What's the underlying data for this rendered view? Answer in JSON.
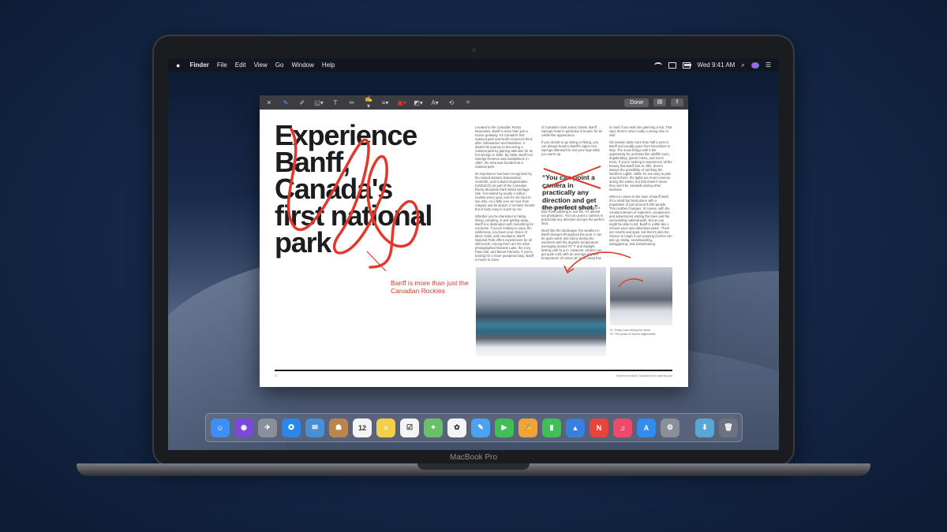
{
  "device": {
    "brand_label": "MacBook Pro"
  },
  "menubar": {
    "apple": "",
    "app_name": "Finder",
    "items": [
      "File",
      "Edit",
      "View",
      "Go",
      "Window",
      "Help"
    ],
    "clock": "Wed 9:41 AM"
  },
  "toolbar": {
    "done_label": "Done",
    "icons": [
      "close-icon",
      "sketch-icon",
      "draw-icon",
      "shapes-icon",
      "text-icon",
      "highlight-icon",
      "sign-icon",
      "line-style-icon",
      "border-color-icon",
      "fill-color-icon",
      "font-icon",
      "rotate-icon",
      "crop-icon",
      "trash-icon",
      "share-icon"
    ]
  },
  "document": {
    "headline": "Experience Banff, Canada's first national park",
    "headline_lines": [
      "Experience",
      "Banff,",
      "Canada's",
      "first national",
      "park"
    ],
    "col1": [
      "Located in the Canadian Rocky Mountains, Banff is more than just a scenic getaway. It's Canada's first national park and North America's third, after Yellowstone and Mackinac. It started its journey to becoming a national park by gaining attention for its hot springs in 1883. By 1885, Banff Hot Springs Reserve was established. In 1887, the area was founded as a national park.",
      "Its importance has been recognized by the United Nations Educational, Scientific, and Cultural Organization (UNESCO) as part of the Canadian Rocky Mountain Park World Heritage Site. It is visited by nearly 4 million tourists every year, and it's not hard to see why. As a little over an hour from Calgary and its airport, it remains remote but is fairly easy to reach by car.",
      "Whether you're interested in hiking, skiing, camping, or just getting away, Banff is a destination with something for everyone. If you're looking to enjoy the wilderness, you have your choice of lakes, trails, and mountains. Banff National Park offers experiences for all skill levels. Among them are the often-photographed Moraine Lake, the Cory Pass trail, and Mount Fairview. If you're looking for a more pampered stay, Banff is home to some"
    ],
    "col2_top": [
      "of Canada's most scenic hotels. Banff Springs Hotel in particular is known for its castle-like appearance.",
      "If you decide to go skiing or hiking, you can always head to Banff's Upper Hot Springs afterward to rest your legs while you warm up."
    ],
    "pullquote": "“You can point a camera in practically any direction and get the perfect shot.”",
    "col2_bottom": [
      "Either way, visiting Banff is like visiting a Bob Ross painting in real life. It's almost too photogenic. You can point a camera in practically any direction and get the perfect shot.",
      "Much like the landscape, the weather in Banff changes throughout the year. It can be quite warm and sunny during the summers with the daytime temperature averaging around 70° F and daylight lasting until 11 p.m. However, winters can get quite cold, with an average daytime temperature of minus 15° F. So keep this"
    ],
    "col3": [
      "in mind if you look into planning a trip. That said, there's never really a wrong time to visit.",
      "Ski season lasts more than half a year in Banff and usually goes from November to May. The snow brings with it the opportunity for activities like wildlife tours, dogsledding, glacier hikes, and much more. If you're looking to experience all the beauty that Banff has to offer, there's always the possibility of catching the Northern Lights. While it's not easy to plan around them, the lights are most common during the winter, but that doesn't mean they won't be viewable during other seasons.",
      "When it comes to the town of Banff itself, it's a small but lively place with a population of just around 9,000 people. This number changes, of course, with the constant stream of explorers, vacationers, and adventurers visiting the town and the surrounding national park. But as you might be able to tell, Banff is a little like a choose-your-own-adventure place. There are resorts and spas, but there's also the chance to tough it out camping (inches can also go skiing, snowboarding, tobogganing, and snowshoeing."
    ],
    "caption_lines": [
      "01. Peyto Lake during the winter",
      "02. The peaks of Mount Inglismaldie"
    ],
    "footer_left": "27",
    "footer_right": "Experience Banff, Canada's first national park",
    "annotation": "Banff is more than just the Canadian Rockies"
  },
  "colors": {
    "annotation": "#e0392b",
    "accent": "#5aa0ff"
  },
  "dock": {
    "apps": [
      {
        "name": "finder",
        "color": "#3d8ff5",
        "glyph": "☺"
      },
      {
        "name": "siri",
        "color": "#7a4ad6",
        "glyph": "◉"
      },
      {
        "name": "launchpad",
        "color": "#8a8f99",
        "glyph": "✈"
      },
      {
        "name": "safari",
        "color": "#2a86e8",
        "glyph": "✪"
      },
      {
        "name": "mail",
        "color": "#4a8fd6",
        "glyph": "✉"
      },
      {
        "name": "contacts",
        "color": "#b8864e",
        "glyph": "☗"
      },
      {
        "name": "calendar",
        "color": "#f4f4f4",
        "glyph": "12"
      },
      {
        "name": "notes",
        "color": "#f2d04a",
        "glyph": "≡"
      },
      {
        "name": "reminders",
        "color": "#f4f4f4",
        "glyph": "☑"
      },
      {
        "name": "maps",
        "color": "#6cbf6a",
        "glyph": "⌖"
      },
      {
        "name": "photos",
        "color": "#f4f4f4",
        "glyph": "✿"
      },
      {
        "name": "messages",
        "color": "#4aa3f0",
        "glyph": "✎"
      },
      {
        "name": "facetime",
        "color": "#3fbf55",
        "glyph": "▶"
      },
      {
        "name": "pages",
        "color": "#f0a33a",
        "glyph": "✍"
      },
      {
        "name": "numbers",
        "color": "#3fbf55",
        "glyph": "▮"
      },
      {
        "name": "keynote",
        "color": "#3a7fe0",
        "glyph": "▲"
      },
      {
        "name": "news",
        "color": "#e8443a",
        "glyph": "N"
      },
      {
        "name": "music",
        "color": "#f04a6a",
        "glyph": "♫"
      },
      {
        "name": "app-store",
        "color": "#2f8cf0",
        "glyph": "A"
      },
      {
        "name": "system-preferences",
        "color": "#8a8f99",
        "glyph": "⚙"
      }
    ],
    "extras": [
      {
        "name": "downloads-folder",
        "color": "#5aa6d6",
        "glyph": "⬇"
      },
      {
        "name": "trash",
        "color": "#6b7280",
        "glyph": "🗑"
      }
    ]
  }
}
